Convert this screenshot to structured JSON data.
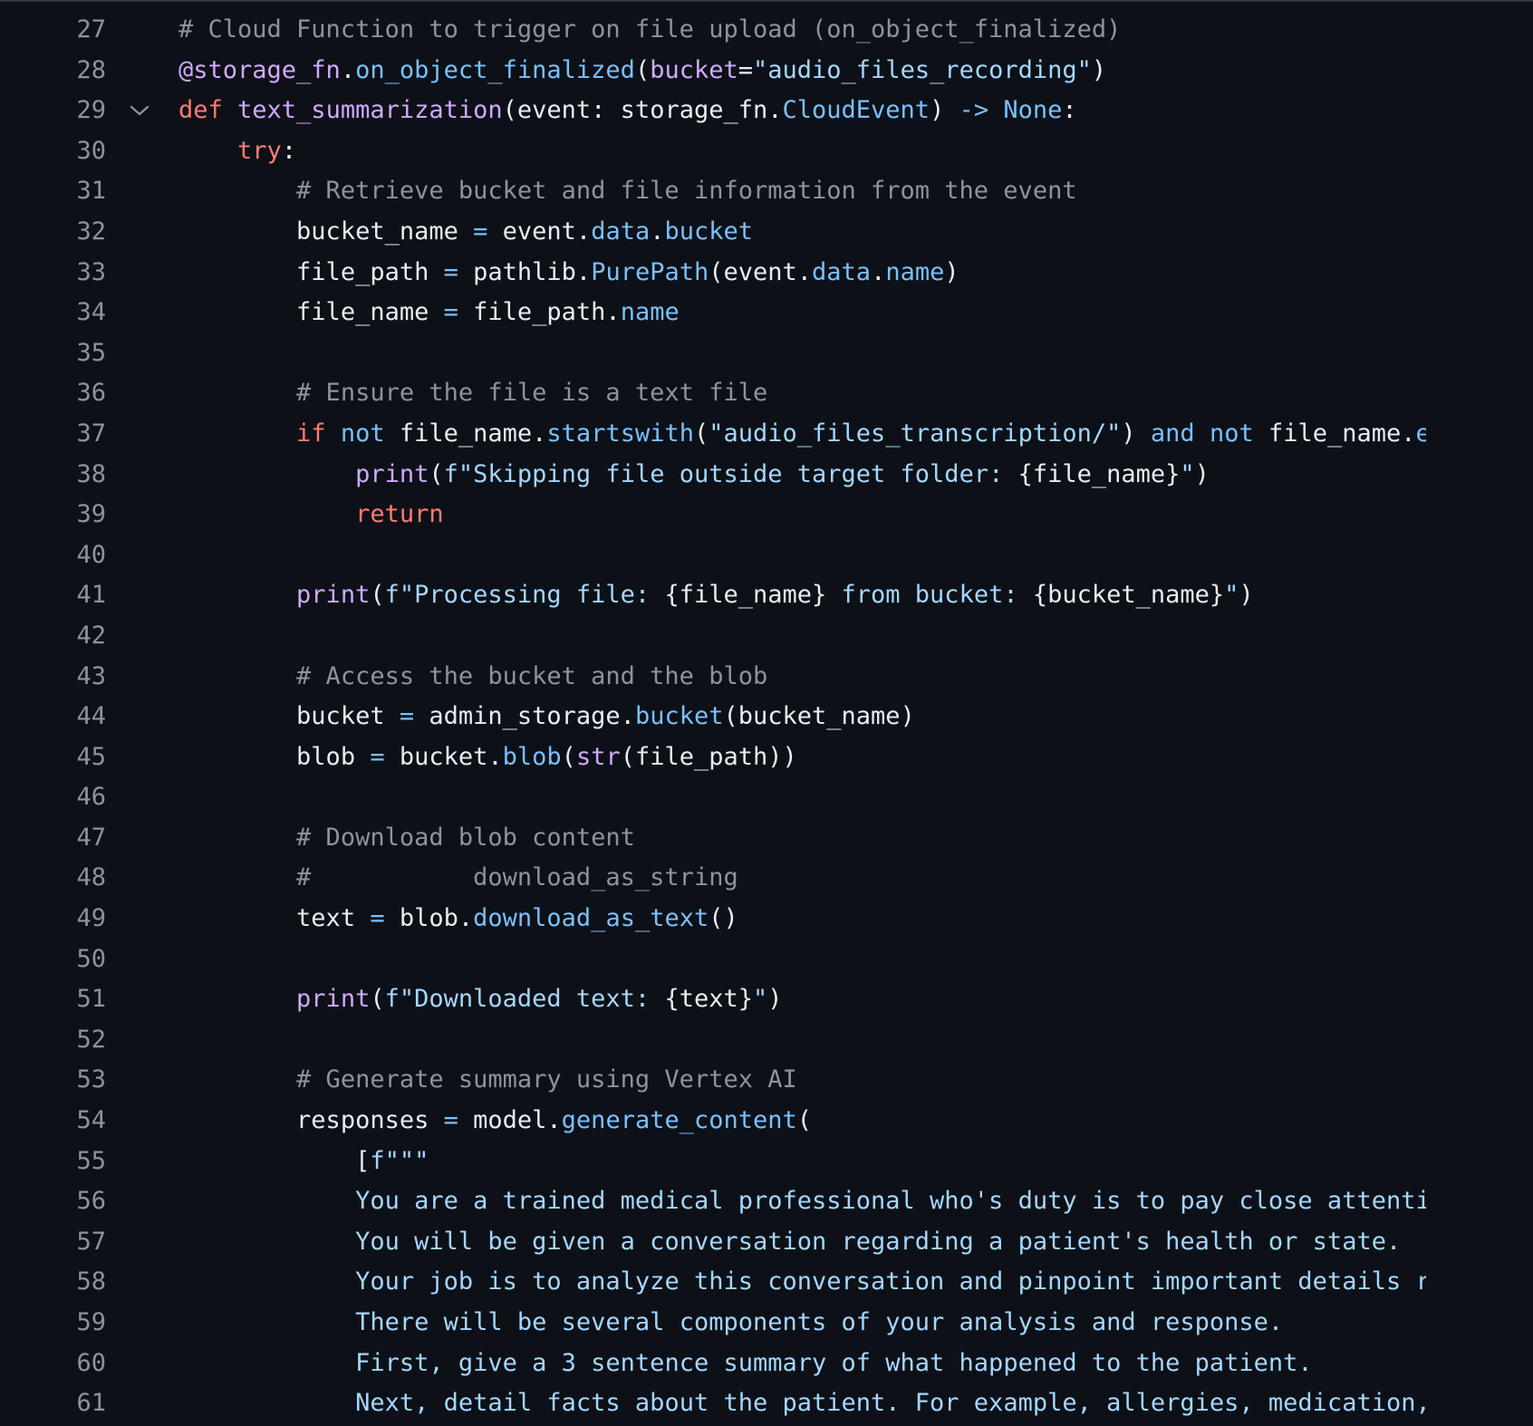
{
  "lines": [
    {
      "n": "27",
      "indent": "",
      "tokens": [
        {
          "t": "# Cloud Function to trigger on file upload (on_object_finalized)",
          "c": "comment"
        }
      ]
    },
    {
      "n": "28",
      "indent": "",
      "tokens": [
        {
          "t": "@storage_fn",
          "c": "fn"
        },
        {
          "t": ".",
          "c": "plain"
        },
        {
          "t": "on_object_finalized",
          "c": "attr"
        },
        {
          "t": "(",
          "c": "plain"
        },
        {
          "t": "bucket",
          "c": "fn"
        },
        {
          "t": "=",
          "c": "plain"
        },
        {
          "t": "\"audio_files_recording\"",
          "c": "str"
        },
        {
          "t": ")",
          "c": "plain"
        }
      ]
    },
    {
      "n": "29",
      "indent": "",
      "fold": true,
      "tokens": [
        {
          "t": "def ",
          "c": "kw"
        },
        {
          "t": "text_summarization",
          "c": "fn"
        },
        {
          "t": "(event: storage_fn.",
          "c": "plain"
        },
        {
          "t": "CloudEvent",
          "c": "attr"
        },
        {
          "t": ") ",
          "c": "plain"
        },
        {
          "t": "-> None",
          "c": "kw2"
        },
        {
          "t": ":",
          "c": "plain"
        }
      ]
    },
    {
      "n": "30",
      "indent": "    ",
      "tokens": [
        {
          "t": "try",
          "c": "kw"
        },
        {
          "t": ":",
          "c": "plain"
        }
      ]
    },
    {
      "n": "31",
      "indent": "        ",
      "tokens": [
        {
          "t": "# Retrieve bucket and file information from the event",
          "c": "comment"
        }
      ]
    },
    {
      "n": "32",
      "indent": "        ",
      "tokens": [
        {
          "t": "bucket_name ",
          "c": "plain"
        },
        {
          "t": "=",
          "c": "kw2"
        },
        {
          "t": " event.",
          "c": "plain"
        },
        {
          "t": "data",
          "c": "attr"
        },
        {
          "t": ".",
          "c": "plain"
        },
        {
          "t": "bucket",
          "c": "attr"
        }
      ]
    },
    {
      "n": "33",
      "indent": "        ",
      "tokens": [
        {
          "t": "file_path ",
          "c": "plain"
        },
        {
          "t": "=",
          "c": "kw2"
        },
        {
          "t": " pathlib.",
          "c": "plain"
        },
        {
          "t": "PurePath",
          "c": "attr"
        },
        {
          "t": "(event.",
          "c": "plain"
        },
        {
          "t": "data",
          "c": "attr"
        },
        {
          "t": ".",
          "c": "plain"
        },
        {
          "t": "name",
          "c": "attr"
        },
        {
          "t": ")",
          "c": "plain"
        }
      ]
    },
    {
      "n": "34",
      "indent": "        ",
      "tokens": [
        {
          "t": "file_name ",
          "c": "plain"
        },
        {
          "t": "=",
          "c": "kw2"
        },
        {
          "t": " file_path.",
          "c": "plain"
        },
        {
          "t": "name",
          "c": "attr"
        }
      ]
    },
    {
      "n": "35",
      "indent": "",
      "tokens": []
    },
    {
      "n": "36",
      "indent": "        ",
      "tokens": [
        {
          "t": "# Ensure the file is a text file",
          "c": "comment"
        }
      ]
    },
    {
      "n": "37",
      "indent": "        ",
      "tokens": [
        {
          "t": "if ",
          "c": "kw"
        },
        {
          "t": "not",
          "c": "kw2"
        },
        {
          "t": " file_name.",
          "c": "plain"
        },
        {
          "t": "startswith",
          "c": "attr"
        },
        {
          "t": "(",
          "c": "plain"
        },
        {
          "t": "\"audio_files_transcription/\"",
          "c": "str"
        },
        {
          "t": ") ",
          "c": "plain"
        },
        {
          "t": "and not",
          "c": "kw2"
        },
        {
          "t": " file_name.",
          "c": "plain"
        },
        {
          "t": "en",
          "c": "attr"
        }
      ]
    },
    {
      "n": "38",
      "indent": "            ",
      "tokens": [
        {
          "t": "print",
          "c": "fn"
        },
        {
          "t": "(",
          "c": "plain"
        },
        {
          "t": "f\"Skipping file outside target folder: ",
          "c": "str"
        },
        {
          "t": "{file_name}",
          "c": "plain"
        },
        {
          "t": "\"",
          "c": "str"
        },
        {
          "t": ")",
          "c": "plain"
        }
      ]
    },
    {
      "n": "39",
      "indent": "            ",
      "tokens": [
        {
          "t": "return",
          "c": "kw"
        }
      ]
    },
    {
      "n": "40",
      "indent": "",
      "tokens": []
    },
    {
      "n": "41",
      "indent": "        ",
      "tokens": [
        {
          "t": "print",
          "c": "fn"
        },
        {
          "t": "(",
          "c": "plain"
        },
        {
          "t": "f\"Processing file: ",
          "c": "str"
        },
        {
          "t": "{file_name}",
          "c": "plain"
        },
        {
          "t": " from bucket: ",
          "c": "str"
        },
        {
          "t": "{bucket_name}",
          "c": "plain"
        },
        {
          "t": "\"",
          "c": "str"
        },
        {
          "t": ")",
          "c": "plain"
        }
      ]
    },
    {
      "n": "42",
      "indent": "",
      "tokens": []
    },
    {
      "n": "43",
      "indent": "        ",
      "tokens": [
        {
          "t": "# Access the bucket and the blob",
          "c": "comment"
        }
      ]
    },
    {
      "n": "44",
      "indent": "        ",
      "tokens": [
        {
          "t": "bucket ",
          "c": "plain"
        },
        {
          "t": "=",
          "c": "kw2"
        },
        {
          "t": " admin_storage.",
          "c": "plain"
        },
        {
          "t": "bucket",
          "c": "attr"
        },
        {
          "t": "(bucket_name)",
          "c": "plain"
        }
      ]
    },
    {
      "n": "45",
      "indent": "        ",
      "tokens": [
        {
          "t": "blob ",
          "c": "plain"
        },
        {
          "t": "=",
          "c": "kw2"
        },
        {
          "t": " bucket.",
          "c": "plain"
        },
        {
          "t": "blob",
          "c": "attr"
        },
        {
          "t": "(",
          "c": "plain"
        },
        {
          "t": "str",
          "c": "fn"
        },
        {
          "t": "(file_path))",
          "c": "plain"
        }
      ]
    },
    {
      "n": "46",
      "indent": "",
      "tokens": []
    },
    {
      "n": "47",
      "indent": "        ",
      "tokens": [
        {
          "t": "# Download blob content",
          "c": "comment"
        }
      ]
    },
    {
      "n": "48",
      "indent": "        ",
      "tokens": [
        {
          "t": "#           download_as_string",
          "c": "comment"
        }
      ]
    },
    {
      "n": "49",
      "indent": "        ",
      "tokens": [
        {
          "t": "text ",
          "c": "plain"
        },
        {
          "t": "=",
          "c": "kw2"
        },
        {
          "t": " blob.",
          "c": "plain"
        },
        {
          "t": "download_as_text",
          "c": "attr"
        },
        {
          "t": "()",
          "c": "plain"
        }
      ]
    },
    {
      "n": "50",
      "indent": "",
      "tokens": []
    },
    {
      "n": "51",
      "indent": "        ",
      "tokens": [
        {
          "t": "print",
          "c": "fn"
        },
        {
          "t": "(",
          "c": "plain"
        },
        {
          "t": "f\"Downloaded text: ",
          "c": "str"
        },
        {
          "t": "{text}",
          "c": "plain"
        },
        {
          "t": "\"",
          "c": "str"
        },
        {
          "t": ")",
          "c": "plain"
        }
      ]
    },
    {
      "n": "52",
      "indent": "",
      "tokens": []
    },
    {
      "n": "53",
      "indent": "        ",
      "tokens": [
        {
          "t": "# Generate summary using Vertex AI",
          "c": "comment"
        }
      ]
    },
    {
      "n": "54",
      "indent": "        ",
      "tokens": [
        {
          "t": "responses ",
          "c": "plain"
        },
        {
          "t": "=",
          "c": "kw2"
        },
        {
          "t": " model.",
          "c": "plain"
        },
        {
          "t": "generate_content",
          "c": "attr"
        },
        {
          "t": "(",
          "c": "plain"
        }
      ]
    },
    {
      "n": "55",
      "indent": "            ",
      "tokens": [
        {
          "t": "[",
          "c": "plain"
        },
        {
          "t": "f\"\"\"",
          "c": "str"
        }
      ]
    },
    {
      "n": "56",
      "indent": "            ",
      "tokens": [
        {
          "t": "You are a trained medical professional who's duty is to pay close attenti",
          "c": "str"
        }
      ]
    },
    {
      "n": "57",
      "indent": "            ",
      "tokens": [
        {
          "t": "You will be given a conversation regarding a patient's health or state.",
          "c": "str"
        }
      ]
    },
    {
      "n": "58",
      "indent": "            ",
      "tokens": [
        {
          "t": "Your job is to analyze this conversation and pinpoint important details re",
          "c": "str"
        }
      ]
    },
    {
      "n": "59",
      "indent": "            ",
      "tokens": [
        {
          "t": "There will be several components of your analysis and response.",
          "c": "str"
        }
      ]
    },
    {
      "n": "60",
      "indent": "            ",
      "tokens": [
        {
          "t": "First, give a 3 sentence summary of what happened to the patient.",
          "c": "str"
        }
      ]
    },
    {
      "n": "61",
      "indent": "            ",
      "tokens": [
        {
          "t": "Next, detail facts about the patient. For example, allergies, medication,",
          "c": "str"
        }
      ]
    }
  ],
  "colors": {
    "background": "#0d1117",
    "line_number": "#8b949e",
    "comment": "#8b949e",
    "keyword": "#ff7b72",
    "keyword_alt": "#79c0ff",
    "function": "#d2a8ff",
    "attribute": "#79c0ff",
    "string": "#a5d6ff",
    "plain": "#e6edf3"
  },
  "icons": {
    "fold": "chevron-down-icon"
  }
}
